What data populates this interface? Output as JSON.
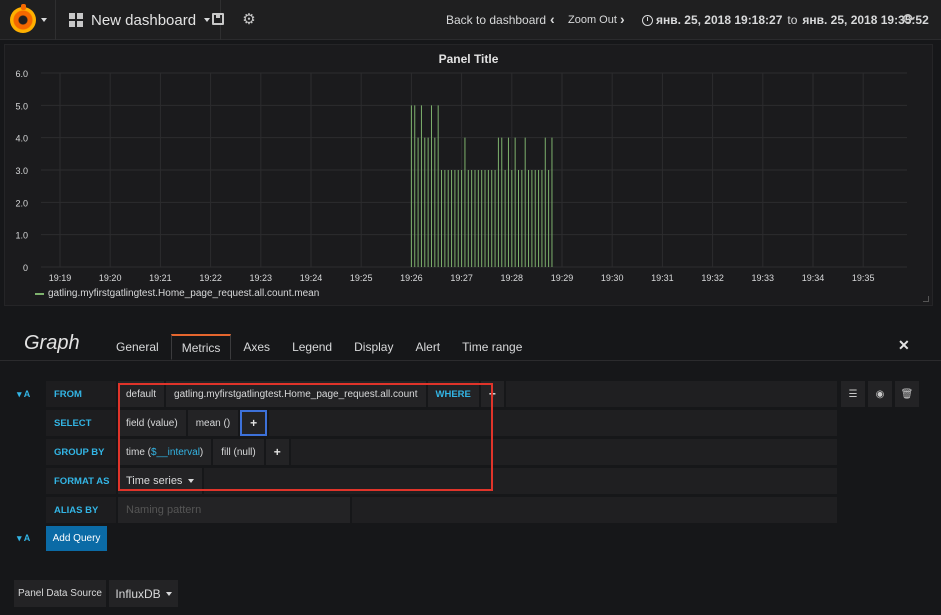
{
  "navbar": {
    "dashboard_title": "New dashboard",
    "back_label": "Back to dashboard",
    "zoom_out_label": "Zoom Out",
    "time_from": "янв. 25, 2018 19:18:27",
    "time_to_word": "to",
    "time_to": "янв. 25, 2018 19:35:52",
    "icons": [
      "grafana-logo-icon",
      "dashboard-grid-icon",
      "save-icon",
      "gear-icon",
      "chevron-left-icon",
      "chevron-right-icon",
      "clock-icon",
      "refresh-icon"
    ]
  },
  "panel": {
    "title": "Panel Title",
    "legend": "gatling.myfirstgatlingtest.Home_page_request.all.count.mean"
  },
  "chart_data": {
    "type": "line",
    "title": "Panel Title",
    "x_ticks": [
      "19:19",
      "19:20",
      "19:21",
      "19:22",
      "19:23",
      "19:24",
      "19:25",
      "19:26",
      "19:27",
      "19:28",
      "19:29",
      "19:30",
      "19:31",
      "19:32",
      "19:33",
      "19:34",
      "19:35"
    ],
    "y_ticks": [
      "6.0",
      "5.0",
      "4.0",
      "3.0",
      "2.0",
      "1.0",
      "0"
    ],
    "ylim": [
      0,
      6
    ],
    "grid": true,
    "legend_position": "bottom-left",
    "series_color": "#7eb26d",
    "series": [
      {
        "name": "gatling.myfirstgatlingtest.Home_page_request.all.count.mean",
        "spikes": [
          {
            "t": "19:26:00",
            "v": 5
          },
          {
            "t": "19:26:04",
            "v": 5
          },
          {
            "t": "19:26:08",
            "v": 4
          },
          {
            "t": "19:26:12",
            "v": 5
          },
          {
            "t": "19:26:16",
            "v": 4
          },
          {
            "t": "19:26:20",
            "v": 4
          },
          {
            "t": "19:26:24",
            "v": 5
          },
          {
            "t": "19:26:28",
            "v": 4
          },
          {
            "t": "19:26:32",
            "v": 5
          },
          {
            "t": "19:26:36",
            "v": 3
          },
          {
            "t": "19:26:40",
            "v": 3
          },
          {
            "t": "19:26:44",
            "v": 3
          },
          {
            "t": "19:26:48",
            "v": 3
          },
          {
            "t": "19:26:52",
            "v": 3
          },
          {
            "t": "19:26:56",
            "v": 3
          },
          {
            "t": "19:27:00",
            "v": 3
          },
          {
            "t": "19:27:04",
            "v": 4
          },
          {
            "t": "19:27:08",
            "v": 3
          },
          {
            "t": "19:27:12",
            "v": 3
          },
          {
            "t": "19:27:16",
            "v": 3
          },
          {
            "t": "19:27:20",
            "v": 3
          },
          {
            "t": "19:27:24",
            "v": 3
          },
          {
            "t": "19:27:28",
            "v": 3
          },
          {
            "t": "19:27:32",
            "v": 3
          },
          {
            "t": "19:27:36",
            "v": 3
          },
          {
            "t": "19:27:40",
            "v": 3
          },
          {
            "t": "19:27:44",
            "v": 4
          },
          {
            "t": "19:27:48",
            "v": 4
          },
          {
            "t": "19:27:52",
            "v": 3
          },
          {
            "t": "19:27:56",
            "v": 4
          },
          {
            "t": "19:28:00",
            "v": 3
          },
          {
            "t": "19:28:04",
            "v": 4
          },
          {
            "t": "19:28:08",
            "v": 3
          },
          {
            "t": "19:28:12",
            "v": 3
          },
          {
            "t": "19:28:16",
            "v": 4
          },
          {
            "t": "19:28:20",
            "v": 3
          },
          {
            "t": "19:28:24",
            "v": 3
          },
          {
            "t": "19:28:28",
            "v": 3
          },
          {
            "t": "19:28:32",
            "v": 3
          },
          {
            "t": "19:28:36",
            "v": 3
          },
          {
            "t": "19:28:40",
            "v": 4
          },
          {
            "t": "19:28:44",
            "v": 3
          },
          {
            "t": "19:28:48",
            "v": 4
          }
        ]
      }
    ]
  },
  "editor": {
    "title": "Graph",
    "tabs": [
      "General",
      "Metrics",
      "Axes",
      "Legend",
      "Display",
      "Alert",
      "Time range"
    ],
    "active_tab": "Metrics",
    "query_letter": "A",
    "from_label": "FROM",
    "from_policy": "default",
    "from_measurement": "gatling.myfirstgatlingtest.Home_page_request.all.count",
    "where_label": "WHERE",
    "select_label": "SELECT",
    "select_field": "field (value)",
    "select_func": "mean ()",
    "groupby_label": "GROUP BY",
    "groupby_time_prefix": "time (",
    "groupby_time_var": "$__interval",
    "groupby_time_suffix": ")",
    "groupby_fill": "fill (null)",
    "format_label": "FORMAT AS",
    "format_value": "Time series",
    "alias_label": "ALIAS BY",
    "alias_placeholder": "Naming pattern",
    "plus": "+",
    "add_query_label": "Add Query",
    "datasource_label": "Panel Data Source",
    "datasource_value": "InfluxDB"
  }
}
